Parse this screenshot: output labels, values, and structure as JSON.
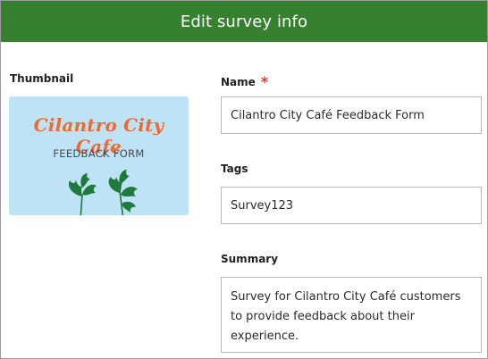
{
  "header": {
    "title": "Edit survey info"
  },
  "thumbnail": {
    "label": "Thumbnail",
    "title": "Cilantro City Cafe",
    "subtitle": "FEEDBACK FORM",
    "background_color": "#bfe3f6",
    "title_color": "#ef6a2f",
    "icon": "cilantro-leaves-icon"
  },
  "name": {
    "label": "Name",
    "required_mark": "*",
    "value": "Cilantro City Café Feedback Form"
  },
  "tags": {
    "label": "Tags",
    "value": "Survey123"
  },
  "summary": {
    "label": "Summary",
    "value": "Survey for Cilantro City Café customers to provide feedback about their experience."
  },
  "colors": {
    "header": "#35812f",
    "required": "#d6402f",
    "border": "#b8b8b8"
  }
}
